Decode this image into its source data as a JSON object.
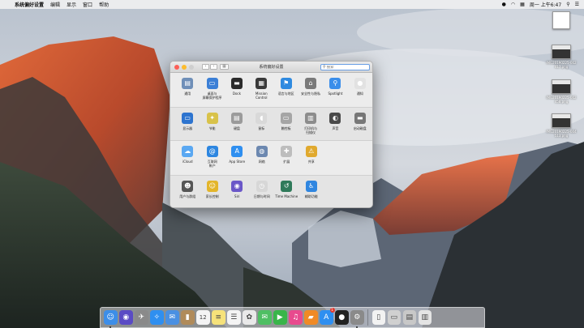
{
  "menubar": {
    "app_name": "系统偏好设置",
    "menus": [
      "编辑",
      "显示",
      "窗口",
      "帮助"
    ],
    "clock": "周一 上午6:47"
  },
  "desktop_items": [
    {
      "label": "",
      "kind": "doc"
    },
    {
      "label": "IMG20190225-002\n417.png",
      "kind": "shot"
    },
    {
      "label": "IMG20190225-002\n458.png",
      "kind": "shot"
    },
    {
      "label": "IMG20190225-004\n513.png",
      "kind": "shot"
    }
  ],
  "window": {
    "title": "系统偏好设置",
    "search_placeholder": "搜索",
    "sections": [
      [
        {
          "label": "通用",
          "icon": "general-icon",
          "glyph": "▤",
          "color": "#6f8fb8"
        },
        {
          "label": "桌面与\n屏幕保护程序",
          "icon": "desktop-icon",
          "glyph": "▭",
          "color": "#3b7fd6"
        },
        {
          "label": "Dock",
          "icon": "dock-icon",
          "glyph": "▬",
          "color": "#2b2b2b"
        },
        {
          "label": "Mission\nControl",
          "icon": "mission-control-icon",
          "glyph": "▦",
          "color": "#3a3a3a"
        },
        {
          "label": "语言与地区",
          "icon": "language-icon",
          "glyph": "⚑",
          "color": "#2f8ae0"
        },
        {
          "label": "安全性与隐私",
          "icon": "security-icon",
          "glyph": "⌂",
          "color": "#7a7a7a"
        },
        {
          "label": "Spotlight",
          "icon": "spotlight-icon",
          "glyph": "⚲",
          "color": "#3b8eea"
        },
        {
          "label": "通知",
          "icon": "notifications-icon",
          "glyph": "●",
          "color": "#e2e2e2"
        }
      ],
      [
        {
          "label": "显示器",
          "icon": "displays-icon",
          "glyph": "▭",
          "color": "#2d74cf"
        },
        {
          "label": "节能",
          "icon": "energy-saver-icon",
          "glyph": "✦",
          "color": "#d8c24a"
        },
        {
          "label": "键盘",
          "icon": "keyboard-icon",
          "glyph": "▤",
          "color": "#9b9b9b"
        },
        {
          "label": "鼠标",
          "icon": "mouse-icon",
          "glyph": "◖",
          "color": "#d9d9d9"
        },
        {
          "label": "触控板",
          "icon": "trackpad-icon",
          "glyph": "▭",
          "color": "#a5a5a5"
        },
        {
          "label": "打印机与\n扫描仪",
          "icon": "printers-icon",
          "glyph": "▥",
          "color": "#8c8c8c"
        },
        {
          "label": "声音",
          "icon": "sound-icon",
          "glyph": "◐",
          "color": "#4a4a4a"
        },
        {
          "label": "启动磁盘",
          "icon": "startup-disk-icon",
          "glyph": "▬",
          "color": "#777777"
        }
      ],
      [
        {
          "label": "iCloud",
          "icon": "icloud-icon",
          "glyph": "☁",
          "color": "#5aa8f2"
        },
        {
          "label": "互联网\n帐户",
          "icon": "internet-accounts-icon",
          "glyph": "@",
          "color": "#2d86e0"
        },
        {
          "label": "App Store",
          "icon": "app-store-icon",
          "glyph": "A",
          "color": "#2f8ff0"
        },
        {
          "label": "网络",
          "icon": "network-icon",
          "glyph": "◍",
          "color": "#6c88b0"
        },
        {
          "label": "扩展",
          "icon": "extensions-icon",
          "glyph": "✚",
          "color": "#bdbdbd"
        },
        {
          "label": "共享",
          "icon": "sharing-icon",
          "glyph": "⚠",
          "color": "#e0a92e"
        }
      ],
      [
        {
          "label": "用户与群组",
          "icon": "users-groups-icon",
          "glyph": "☻",
          "color": "#555555"
        },
        {
          "label": "家长控制",
          "icon": "parental-controls-icon",
          "glyph": "☺",
          "color": "#e3b52b"
        },
        {
          "label": "Siri",
          "icon": "siri-icon",
          "glyph": "◉",
          "color": "#6a57c8"
        },
        {
          "label": "日期与时间",
          "icon": "date-time-icon",
          "glyph": "◷",
          "color": "#d7d7d7"
        },
        {
          "label": "Time Machine",
          "icon": "time-machine-icon",
          "glyph": "↺",
          "color": "#2f7a5a"
        },
        {
          "label": "辅助功能",
          "icon": "accessibility-icon",
          "glyph": "♿",
          "color": "#2f86e0"
        }
      ]
    ]
  },
  "dock": [
    {
      "icon": "finder-icon",
      "glyph": "☺",
      "color": "#3d8ee8",
      "running": true
    },
    {
      "icon": "siri-icon",
      "glyph": "◉",
      "color": "#5a4bc4"
    },
    {
      "icon": "launchpad-icon",
      "glyph": "✈",
      "color": "#8a8a8a"
    },
    {
      "icon": "safari-icon",
      "glyph": "✧",
      "color": "#2f8ff0"
    },
    {
      "icon": "mail-icon",
      "glyph": "✉",
      "color": "#4a90e2"
    },
    {
      "icon": "contacts-icon",
      "glyph": "▮",
      "color": "#b08b5a"
    },
    {
      "icon": "calendar-icon",
      "glyph": "12",
      "color": "#f4f4f4",
      "dark": true
    },
    {
      "icon": "notes-icon",
      "glyph": "≡",
      "color": "#f6e27a",
      "dark": true
    },
    {
      "icon": "reminders-icon",
      "glyph": "☰",
      "color": "#f4f4f4",
      "dark": true
    },
    {
      "icon": "photos-icon",
      "glyph": "✿",
      "color": "#e9e9e9",
      "dark": true
    },
    {
      "icon": "messages-icon",
      "glyph": "✉",
      "color": "#4fbf63"
    },
    {
      "icon": "facetime-icon",
      "glyph": "▶",
      "color": "#39b54a"
    },
    {
      "icon": "itunes-icon",
      "glyph": "♫",
      "color": "#e84a8e"
    },
    {
      "icon": "ibooks-icon",
      "glyph": "▰",
      "color": "#f08a25"
    },
    {
      "icon": "app-store-icon",
      "glyph": "A",
      "color": "#2f8ff0",
      "badge": "1"
    },
    {
      "icon": "qq-icon",
      "glyph": "●",
      "color": "#222222"
    },
    {
      "icon": "system-preferences-icon",
      "glyph": "⚙",
      "color": "#8a8a8a",
      "running": true
    },
    {
      "sep": true
    },
    {
      "icon": "document-icon",
      "glyph": "▯",
      "color": "#f2f2f2",
      "dark": true
    },
    {
      "icon": "screenshots-stack-icon",
      "glyph": "▭",
      "color": "#d0d0d0",
      "dark": true
    },
    {
      "icon": "folder-stack-icon",
      "glyph": "▤",
      "color": "#c8c8c8",
      "dark": true
    },
    {
      "icon": "trash-icon",
      "glyph": "▥",
      "color": "#e4e4e4",
      "dark": true
    }
  ]
}
